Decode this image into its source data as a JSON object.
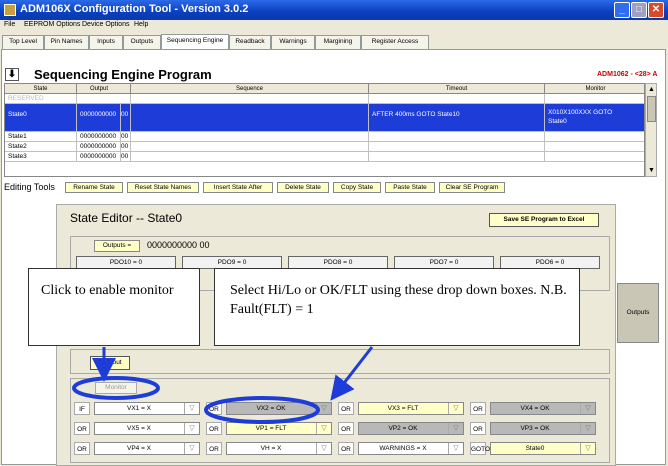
{
  "window": {
    "title": "ADM106X Configuration Tool - Version 3.0.2",
    "buttons": {
      "minimize": "_",
      "maximize": "□",
      "close": "✕"
    }
  },
  "menubar": {
    "items": [
      "File",
      "EEPROM Options",
      "Device Options",
      "Help"
    ]
  },
  "tabs": [
    "Top Level",
    "Pin Names",
    "Inputs",
    "Outputs",
    "Sequencing Engine",
    "Readback",
    "Warnings",
    "Margining",
    "Register Access"
  ],
  "active_tab": "Sequencing Engine",
  "program": {
    "down_button": "⬇",
    "title": "Sequencing Engine Program",
    "device": "ADM1062 - <28> A"
  },
  "grid": {
    "headers": [
      "State",
      "Output",
      "Sequence",
      "Timeout",
      "Monitor"
    ],
    "rows": [
      {
        "state": "RESERVED",
        "output": "",
        "seq": "",
        "sequence": "",
        "timeout": "",
        "monitor": ""
      },
      {
        "state": "State0",
        "output": "0000000000",
        "seq": "00",
        "sequence": "",
        "timeout": "AFTER 400ms GOTO State10",
        "monitor": "X010X100XXX GOTO",
        "monitor2": "State0"
      },
      {
        "state": "State1",
        "output": "0000000000",
        "seq": "00",
        "sequence": "",
        "timeout": "",
        "monitor": ""
      },
      {
        "state": "State2",
        "output": "0000000000",
        "seq": "00",
        "sequence": "",
        "timeout": "",
        "monitor": ""
      },
      {
        "state": "State3",
        "output": "0000000000",
        "seq": "00",
        "sequence": "",
        "timeout": "",
        "monitor": ""
      }
    ],
    "scroll": {
      "up": "▲",
      "down": "▼"
    }
  },
  "editing": {
    "label": "Editing Tools",
    "buttons": [
      "Rename State",
      "Reset State Names",
      "Insert State After",
      "Delete State",
      "Copy State",
      "Paste State",
      "Clear SE Program"
    ]
  },
  "editor": {
    "title": "State Editor   --   State0",
    "save_excel": "Save SE Program to Excel",
    "outputs_btn": "Outputs =",
    "outputs_value": "0000000000  00",
    "pdo": [
      "PDO10 = 0",
      "PDO9 = 0",
      "PDO8 = 0",
      "PDO7 = 0",
      "PDO6 = 0"
    ],
    "outputs_side": "Outputs",
    "timeout_btn": "Timeout",
    "monitor_btn": "Monitor",
    "conditions": [
      [
        {
          "logic": "IF",
          "text": "VX1 = X",
          "style": "white"
        },
        {
          "logic": "OR",
          "text": "VX2 = OK",
          "style": "gray"
        },
        {
          "logic": "OR",
          "text": "VX3 = FLT",
          "style": "yellow"
        },
        {
          "logic": "OR",
          "text": "VX4 = OK",
          "style": "gray"
        }
      ],
      [
        {
          "logic": "OR",
          "text": "VX5 = X",
          "style": "white"
        },
        {
          "logic": "OR",
          "text": "VP1 = FLT",
          "style": "yellow"
        },
        {
          "logic": "OR",
          "text": "VP2 = OK",
          "style": "gray"
        },
        {
          "logic": "OR",
          "text": "VP3 = OK",
          "style": "gray"
        }
      ],
      [
        {
          "logic": "OR",
          "text": "VP4 = X",
          "style": "white"
        },
        {
          "logic": "OR",
          "text": "VH = X",
          "style": "white"
        },
        {
          "logic": "OR",
          "text": "WARNINGS = X",
          "style": "white"
        },
        {
          "logic": "GOTO",
          "text": "State0",
          "style": "yellow"
        }
      ]
    ],
    "dropdown_glyph": "▽"
  },
  "callouts": {
    "monitor": "Click to enable monitor",
    "dropdown": "Select Hi/Lo or OK/FLT using these drop down boxes. N.B. Fault(FLT) = 1"
  },
  "colors": {
    "annotation": "#1e3cd8",
    "selection": "#1e3cd8",
    "device_label": "#d00000",
    "title_bar": "#0a3fbf"
  }
}
